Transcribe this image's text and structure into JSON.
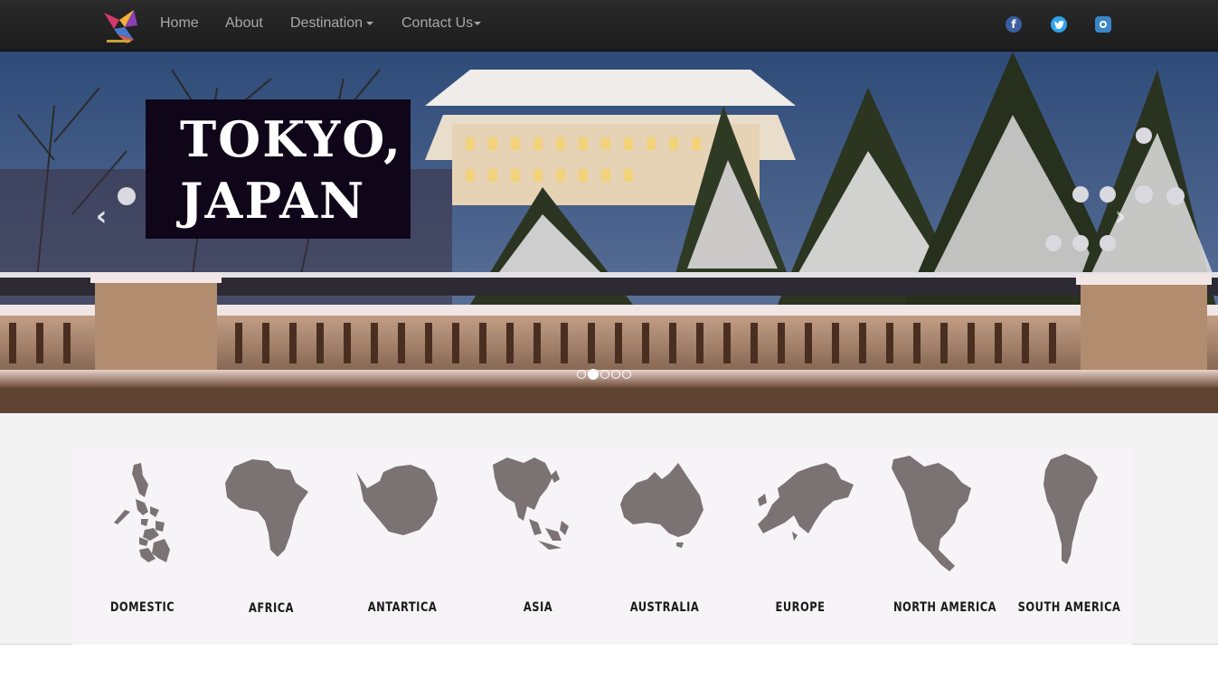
{
  "nav": {
    "logo_icon": "origami-bird-logo-icon",
    "items": [
      {
        "label": "Home",
        "dropdown": false
      },
      {
        "label": "About",
        "dropdown": false
      },
      {
        "label": "Destination",
        "dropdown": true
      },
      {
        "label": "Contact Us",
        "dropdown": true
      }
    ],
    "social": [
      {
        "name": "facebook-icon",
        "glyph": "f"
      },
      {
        "name": "twitter-icon",
        "glyph": "t"
      },
      {
        "name": "instagram-icon",
        "glyph": ""
      }
    ]
  },
  "carousel": {
    "caption_line1": "TOKYO,",
    "caption_line2": "JAPAN",
    "prev_glyph": "‹",
    "next_glyph": "›",
    "slide_count": 5,
    "active_slide": 2
  },
  "destinations": [
    {
      "label": "DOMESTIC",
      "icon": "philippines-map-icon"
    },
    {
      "label": "AFRICA",
      "icon": "africa-map-icon"
    },
    {
      "label": "ANTARTICA",
      "icon": "antarctica-map-icon"
    },
    {
      "label": "ASIA",
      "icon": "asia-map-icon"
    },
    {
      "label": "AUSTRALIA",
      "icon": "australia-map-icon"
    },
    {
      "label": "EUROPE",
      "icon": "europe-map-icon"
    },
    {
      "label": "NORTH AMERICA",
      "icon": "north-america-map-icon"
    },
    {
      "label": "SOUTH AMERICA",
      "icon": "south-america-map-icon"
    }
  ],
  "colors": {
    "navbar": "#222222",
    "nav_text": "#a9a9a9",
    "caption_bg": "#10061a",
    "map_fill": "#7b7273",
    "section_bg": "#f3f3f3"
  }
}
